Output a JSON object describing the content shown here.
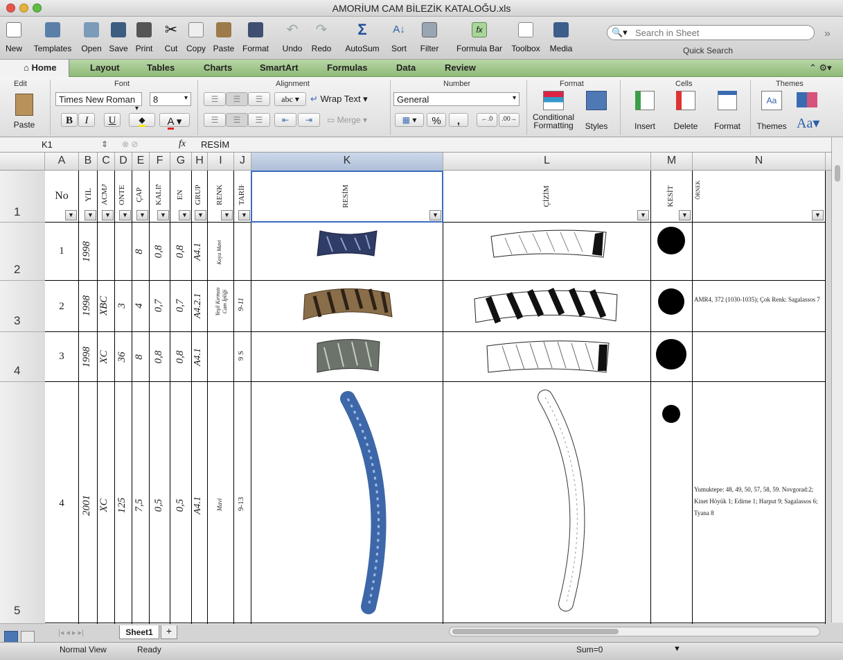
{
  "window": {
    "title": "AMORİUM CAM BİLEZİK KATALOĞU.xls"
  },
  "toolbar": {
    "items": [
      "New",
      "Templates",
      "Open",
      "Save",
      "Print",
      "Cut",
      "Copy",
      "Paste",
      "Format",
      "Undo",
      "Redo",
      "AutoSum",
      "Sort",
      "Filter",
      "Formula Bar",
      "Toolbox",
      "Media"
    ],
    "search_placeholder": "Search in Sheet",
    "search_label": "Quick Search"
  },
  "ribbon_tabs": [
    "Home",
    "Layout",
    "Tables",
    "Charts",
    "SmartArt",
    "Formulas",
    "Data",
    "Review"
  ],
  "ribbon": {
    "groups": [
      "Edit",
      "Font",
      "Alignment",
      "Number",
      "Format",
      "Cells",
      "Themes"
    ],
    "paste": "Paste",
    "font_name": "Times New Roman",
    "font_size": "8",
    "bold": "B",
    "italic": "I",
    "underline": "U",
    "font_color": "A",
    "abc": "abc",
    "wrap_text": "Wrap Text",
    "merge": "Merge",
    "number_format": "General",
    "percent": "%",
    "comma": ",",
    "conditional_formatting": "Conditional Formatting",
    "styles": "Styles",
    "insert": "Insert",
    "delete": "Delete",
    "format": "Format",
    "themes": "Themes",
    "aa": "Aa"
  },
  "formula_bar": {
    "cell_ref": "K1",
    "fx": "fx",
    "content": "RESİM"
  },
  "columns": [
    "A",
    "B",
    "C",
    "D",
    "E",
    "F",
    "G",
    "H",
    "I",
    "J",
    "K",
    "L",
    "M",
    "N"
  ],
  "rows": [
    "1",
    "2",
    "3",
    "4",
    "5"
  ],
  "headers": {
    "A": "No",
    "B": "YIL",
    "C": "ACMA",
    "D": "ONTEKS",
    "E": "ÇAP",
    "F": "KALINLIK",
    "G": "EN",
    "H": "GRUP",
    "I": "RENK",
    "J": "TARİH",
    "K": "RESİM",
    "L": "ÇİZİM",
    "M": "KESİT",
    "N": "ÖRNEK"
  },
  "data_rows": [
    {
      "A": "1",
      "B": "1998",
      "C": "",
      "D": "",
      "E": "8",
      "F": "0,8",
      "G": "0,8",
      "H": "A4.1",
      "I": "Koyu Mavi",
      "J": "",
      "N": ""
    },
    {
      "A": "2",
      "B": "1998",
      "C": "XBC",
      "D": "3",
      "E": "4",
      "F": "0,7",
      "G": "0,7",
      "H": "A4.2.1",
      "I": "Yeşil Kırmızı Cam İpliği",
      "J": "9-11",
      "N": "AMR4, 372 (1030-1035); Çok Renk: Sagalassos 7"
    },
    {
      "A": "3",
      "B": "1998",
      "C": "XC",
      "D": "36",
      "E": "8",
      "F": "0,8",
      "G": "0,8",
      "H": "A4.1",
      "I": "",
      "J": "9 S",
      "N": ""
    },
    {
      "A": "4",
      "B": "2001",
      "C": "XC",
      "D": "125",
      "E": "7,5",
      "F": "0,5",
      "G": "0,5",
      "H": "A4.1",
      "I": "Mavi",
      "J": "9-13",
      "N": "Yumuktepe: 48, 49, 50, 57, 58, 59. Novgorad:2; Kinet Höyük 1; Edirne 1; Harput 9; Sagalassos 6; Tyana 8"
    }
  ],
  "sheet_tab": "Sheet1",
  "status": {
    "view": "Normal View",
    "ready": "Ready",
    "sum": "Sum=0"
  }
}
